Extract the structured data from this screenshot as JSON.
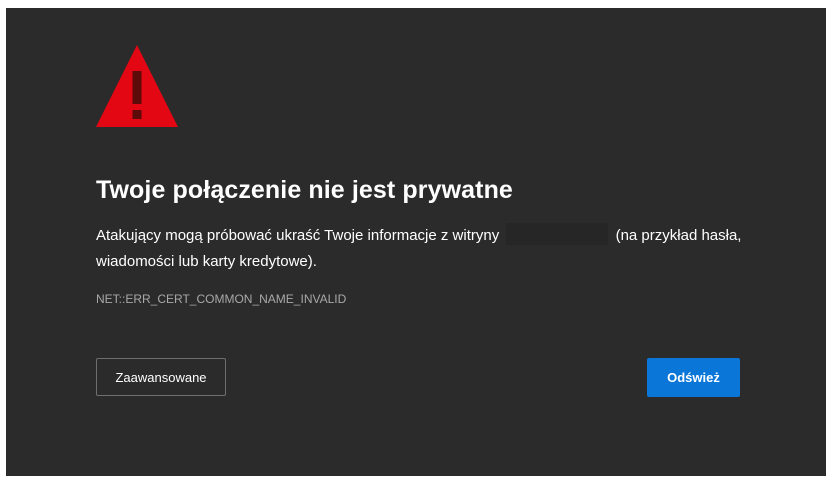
{
  "error_page": {
    "icon": "warning-triangle-icon",
    "icon_color": "#e30613",
    "title": "Twoje połączenie nie jest prywatne",
    "description_before": "Atakujący mogą próbować ukraść Twoje informacje z witryny",
    "description_after": "(na przykład hasła, wiadomości lub karty kredytowe).",
    "error_code": "NET::ERR_CERT_COMMON_NAME_INVALID",
    "advanced_label": "Zaawansowane",
    "refresh_label": "Odśwież",
    "accent_color": "#0a76d8",
    "background_color": "#2b2b2b"
  }
}
